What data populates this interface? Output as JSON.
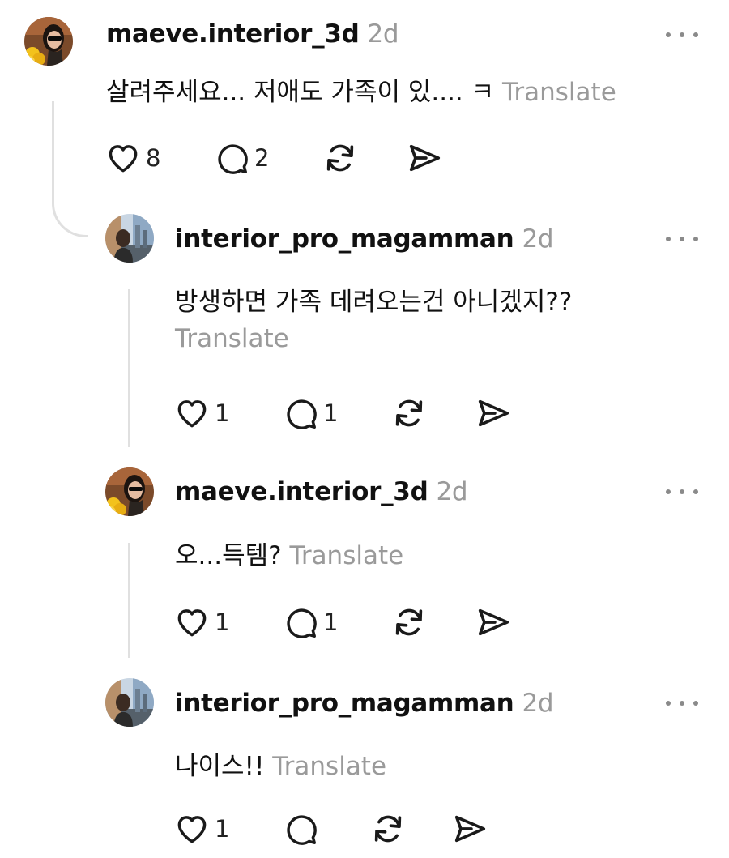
{
  "comments": [
    {
      "username": "maeve.interior_3d",
      "timestamp": "2d",
      "text": "살려주세요... 저애도 가족이 있.... ㅋ",
      "translate": "Translate",
      "likes": "8",
      "replies": "2",
      "avatar_icon": "woman-with-sunglasses-avatar"
    },
    {
      "username": "interior_pro_magamman",
      "timestamp": "2d",
      "text": "방생하면 가족 데려오는건 아니겠지??",
      "translate": "Translate",
      "likes": "1",
      "replies": "1",
      "avatar_icon": "man-city-view-avatar"
    },
    {
      "username": "maeve.interior_3d",
      "timestamp": "2d",
      "text": "오...득템?",
      "translate": "Translate",
      "likes": "1",
      "replies": "1",
      "avatar_icon": "woman-with-sunglasses-avatar"
    },
    {
      "username": "interior_pro_magamman",
      "timestamp": "2d",
      "text": "나이스!!",
      "translate": "Translate",
      "likes": "1",
      "replies": "",
      "avatar_icon": "man-city-view-avatar"
    }
  ],
  "icons": [
    "heart-icon",
    "comment-icon",
    "repost-icon",
    "share-icon",
    "more-options-icon"
  ]
}
